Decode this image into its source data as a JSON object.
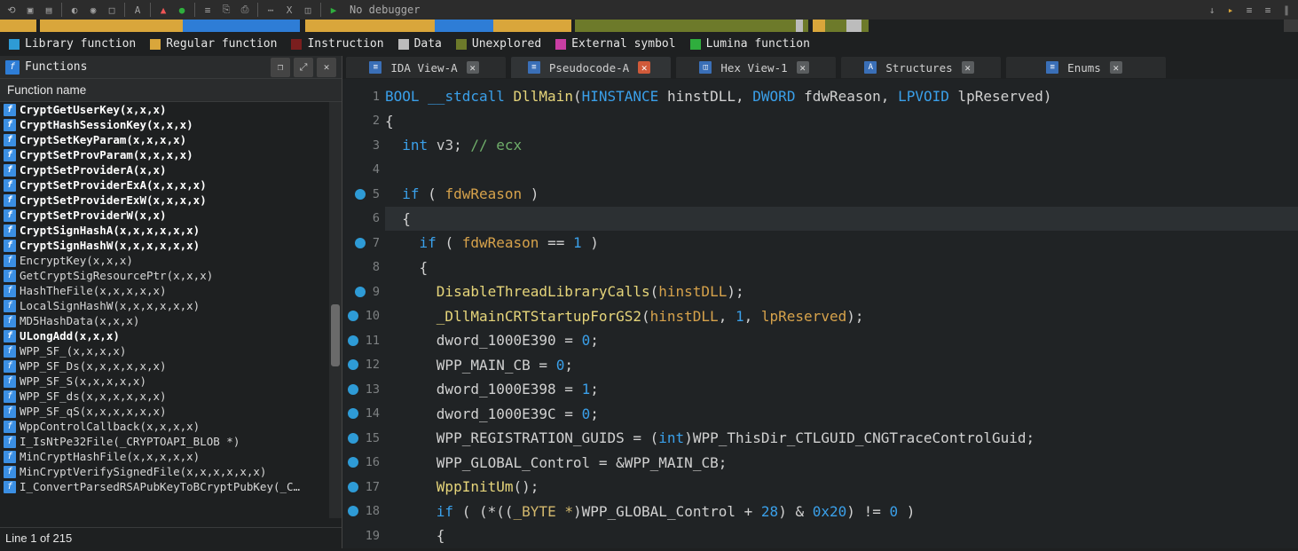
{
  "toolbar": {
    "debugger_label": "No debugger"
  },
  "nav_segments": [
    {
      "w": 2.8,
      "c": "#d9a63b"
    },
    {
      "w": 0.3,
      "c": "#1e2021"
    },
    {
      "w": 11.0,
      "c": "#d9a63b"
    },
    {
      "w": 9.0,
      "c": "#2e7dd6"
    },
    {
      "w": 0.4,
      "c": "#1e2021"
    },
    {
      "w": 10.0,
      "c": "#d9a63b"
    },
    {
      "w": 4.5,
      "c": "#2e7dd6"
    },
    {
      "w": 6.0,
      "c": "#d9a63b"
    },
    {
      "w": 0.3,
      "c": "#1e2021"
    },
    {
      "w": 17.0,
      "c": "#6d7a2a"
    },
    {
      "w": 0.6,
      "c": "#bcbcbc"
    },
    {
      "w": 0.4,
      "c": "#6d7a2a"
    },
    {
      "w": 0.3,
      "c": "#1e2021"
    },
    {
      "w": 1.0,
      "c": "#d9a63b"
    },
    {
      "w": 1.6,
      "c": "#6d7a2a"
    },
    {
      "w": 1.2,
      "c": "#bcbcbc"
    },
    {
      "w": 0.5,
      "c": "#6d7a2a"
    },
    {
      "w": 32.0,
      "c": "#1e2021"
    }
  ],
  "legend": [
    {
      "label": "Library function",
      "color": "#2e9bd6"
    },
    {
      "label": "Regular function",
      "color": "#d9a63b"
    },
    {
      "label": "Instruction",
      "color": "#7a1e1e"
    },
    {
      "label": "Data",
      "color": "#bcbcbc"
    },
    {
      "label": "Unexplored",
      "color": "#6d7a2a"
    },
    {
      "label": "External symbol",
      "color": "#c93ea3"
    },
    {
      "label": "Lumina function",
      "color": "#2fae3d"
    }
  ],
  "functions_panel": {
    "title": "Functions",
    "column": "Function name",
    "footer": "Line 1 of 215",
    "items": [
      {
        "name": "CryptGetUserKey(x,x,x)",
        "bold": true
      },
      {
        "name": "CryptHashSessionKey(x,x,x)",
        "bold": true
      },
      {
        "name": "CryptSetKeyParam(x,x,x,x)",
        "bold": true
      },
      {
        "name": "CryptSetProvParam(x,x,x,x)",
        "bold": true
      },
      {
        "name": "CryptSetProviderA(x,x)",
        "bold": true
      },
      {
        "name": "CryptSetProviderExA(x,x,x,x)",
        "bold": true
      },
      {
        "name": "CryptSetProviderExW(x,x,x,x)",
        "bold": true
      },
      {
        "name": "CryptSetProviderW(x,x)",
        "bold": true
      },
      {
        "name": "CryptSignHashA(x,x,x,x,x,x)",
        "bold": true
      },
      {
        "name": "CryptSignHashW(x,x,x,x,x,x)",
        "bold": true
      },
      {
        "name": "EncryptKey(x,x,x)",
        "bold": false
      },
      {
        "name": "GetCryptSigResourcePtr(x,x,x)",
        "bold": false
      },
      {
        "name": "HashTheFile(x,x,x,x,x)",
        "bold": false
      },
      {
        "name": "LocalSignHashW(x,x,x,x,x,x)",
        "bold": false
      },
      {
        "name": "MD5HashData(x,x,x)",
        "bold": false
      },
      {
        "name": "ULongAdd(x,x,x)",
        "bold": true
      },
      {
        "name": "WPP_SF_(x,x,x,x)",
        "bold": false
      },
      {
        "name": "WPP_SF_Ds(x,x,x,x,x,x)",
        "bold": false
      },
      {
        "name": "WPP_SF_S(x,x,x,x,x)",
        "bold": false
      },
      {
        "name": "WPP_SF_ds(x,x,x,x,x,x)",
        "bold": false
      },
      {
        "name": "WPP_SF_qS(x,x,x,x,x,x)",
        "bold": false
      },
      {
        "name": "WppControlCallback(x,x,x,x)",
        "bold": false
      },
      {
        "name": "I_IsNtPe32File(_CRYPTOAPI_BLOB *)",
        "bold": false
      },
      {
        "name": "MinCryptHashFile(x,x,x,x,x)",
        "bold": false
      },
      {
        "name": "MinCryptVerifySignedFile(x,x,x,x,x,x)",
        "bold": false
      },
      {
        "name": "I_ConvertParsedRSAPubKeyToBCryptPubKey(_C…",
        "bold": false
      }
    ]
  },
  "tabs": [
    {
      "label": "IDA View-A",
      "icon": "≡",
      "close": "gray",
      "active": false
    },
    {
      "label": "Pseudocode-A",
      "icon": "≡",
      "close": "red",
      "active": true
    },
    {
      "label": "Hex View-1",
      "icon": "◫",
      "close": "gray",
      "active": false
    },
    {
      "label": "Structures",
      "icon": "A",
      "close": "gray",
      "active": false
    },
    {
      "label": "Enums",
      "icon": "≡",
      "close": "gray",
      "active": false
    }
  ],
  "code": {
    "lines": [
      {
        "n": 1,
        "bp": false,
        "html": "<span class='t-type'>BOOL</span> <span class='t-kw'>__stdcall</span> <span class='t-func'>DllMain</span><span class='t-punc'>(</span><span class='t-type'>HINSTANCE</span> <span class='t-ident'>hinstDLL</span><span class='t-punc'>,</span> <span class='t-type'>DWORD</span> <span class='t-ident'>fdwReason</span><span class='t-punc'>,</span> <span class='t-type'>LPVOID</span> <span class='t-ident'>lpReserved</span><span class='t-punc'>)</span>"
      },
      {
        "n": 2,
        "bp": false,
        "html": "<span class='t-punc'>{</span>"
      },
      {
        "n": 3,
        "bp": false,
        "html": "  <span class='t-type'>int</span> <span class='t-local'>v3</span><span class='t-punc'>;</span> <span class='t-comment'>// ecx</span>"
      },
      {
        "n": 4,
        "bp": false,
        "html": ""
      },
      {
        "n": 5,
        "bp": true,
        "html": "  <span class='t-kw'>if</span> <span class='t-punc'>(</span> <span class='t-orange'>fdwReason</span> <span class='t-punc'>)</span>"
      },
      {
        "n": 6,
        "bp": false,
        "current": true,
        "html": "  <span class='t-punc'>{</span>"
      },
      {
        "n": 7,
        "bp": true,
        "html": "    <span class='t-kw'>if</span> <span class='t-punc'>(</span> <span class='t-orange'>fdwReason</span> <span class='t-op'>==</span> <span class='t-num'>1</span> <span class='t-punc'>)</span>"
      },
      {
        "n": 8,
        "bp": false,
        "html": "    <span class='t-punc'>{</span>"
      },
      {
        "n": 9,
        "bp": true,
        "html": "      <span class='t-func'>DisableThreadLibraryCalls</span><span class='t-punc'>(</span><span class='t-orange'>hinstDLL</span><span class='t-punc'>);</span>"
      },
      {
        "n": 10,
        "bp": true,
        "html": "      <span class='t-func'>_DllMainCRTStartupForGS2</span><span class='t-punc'>(</span><span class='t-orange'>hinstDLL</span><span class='t-punc'>,</span> <span class='t-num'>1</span><span class='t-punc'>,</span> <span class='t-orange'>lpReserved</span><span class='t-punc'>);</span>"
      },
      {
        "n": 11,
        "bp": true,
        "html": "      <span class='t-ident'>dword_1000E390</span> <span class='t-op'>=</span> <span class='t-num'>0</span><span class='t-punc'>;</span>"
      },
      {
        "n": 12,
        "bp": true,
        "html": "      <span class='t-ident'>WPP_MAIN_CB</span> <span class='t-op'>=</span> <span class='t-num'>0</span><span class='t-punc'>;</span>"
      },
      {
        "n": 13,
        "bp": true,
        "html": "      <span class='t-ident'>dword_1000E398</span> <span class='t-op'>=</span> <span class='t-num'>1</span><span class='t-punc'>;</span>"
      },
      {
        "n": 14,
        "bp": true,
        "html": "      <span class='t-ident'>dword_1000E39C</span> <span class='t-op'>=</span> <span class='t-num'>0</span><span class='t-punc'>;</span>"
      },
      {
        "n": 15,
        "bp": true,
        "html": "      <span class='t-ident'>WPP_REGISTRATION_GUIDS</span> <span class='t-op'>=</span> <span class='t-punc'>(</span><span class='t-type'>int</span><span class='t-punc'>)</span><span class='t-ident'>WPP_ThisDir_CTLGUID_CNGTraceControlGuid</span><span class='t-punc'>;</span>"
      },
      {
        "n": 16,
        "bp": true,
        "html": "      <span class='t-ident'>WPP_GLOBAL_Control</span> <span class='t-op'>=</span> <span class='t-op'>&amp;</span><span class='t-ident'>WPP_MAIN_CB</span><span class='t-punc'>;</span>"
      },
      {
        "n": 17,
        "bp": true,
        "html": "      <span class='t-func'>WppInitUm</span><span class='t-punc'>();</span>"
      },
      {
        "n": 18,
        "bp": true,
        "html": "      <span class='t-kw'>if</span> <span class='t-punc'>(</span> <span class='t-punc'>(</span><span class='t-op'>*</span><span class='t-punc'>((</span><span class='t-macro'>_BYTE *</span><span class='t-punc'>)</span><span class='t-ident'>WPP_GLOBAL_Control</span> <span class='t-op'>+</span> <span class='t-num'>28</span><span class='t-punc'>)</span> <span class='t-op'>&amp;</span> <span class='t-num'>0x20</span><span class='t-punc'>)</span> <span class='t-op'>!=</span> <span class='t-num'>0</span> <span class='t-punc'>)</span>"
      },
      {
        "n": 19,
        "bp": false,
        "html": "      <span class='t-punc'>{</span>"
      }
    ]
  }
}
